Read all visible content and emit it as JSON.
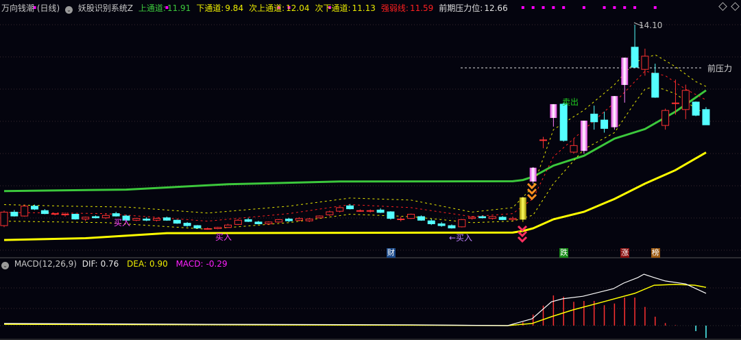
{
  "header": {
    "title": "万向钱潮 (日线)",
    "indicator": "妖股识别系统Z",
    "items": [
      {
        "label": "上通道:",
        "value": "11.91",
        "color": "#3cc83c"
      },
      {
        "label": "下通道:",
        "value": "9.84",
        "color": "#f0f000"
      },
      {
        "label": "次上通道:",
        "value": "12.04",
        "color": "#e8e800"
      },
      {
        "label": "次下通道:",
        "value": "11.13",
        "color": "#e8e800"
      },
      {
        "label": "强弱线:",
        "value": "11.59",
        "color": "#ff2020"
      },
      {
        "label": "前期压力位:",
        "value": "12.66",
        "color": "#e0e0e0"
      }
    ]
  },
  "macd_header": {
    "name": "MACD(12,26,9)",
    "dif_label": "DIF:",
    "dif": "0.76",
    "dea_label": "DEA:",
    "dea": "0.90",
    "macd_label": "MACD:",
    "macd": "-0.29"
  },
  "annotations": {
    "high_label": "14.10",
    "resistance_label": "前压力",
    "buy1": "买入",
    "buy2": "买入",
    "buy3": "←买入",
    "sell": "卖出"
  },
  "events": [
    {
      "index": 38,
      "text": "财",
      "color": "#1c4a8a"
    },
    {
      "index": 55,
      "text": "跌",
      "color": "#188a18"
    },
    {
      "index": 61,
      "text": "涨",
      "color": "#8a1010"
    },
    {
      "index": 64,
      "text": "榜",
      "color": "#9a5810"
    }
  ],
  "colors": {
    "up": "#ff3232",
    "down": "#54ffff",
    "limit": "#ff80ff",
    "gold": "#e0d000",
    "grid": "#3a2a30"
  },
  "chart_data": {
    "type": "candlestick",
    "price_high": 14.1,
    "resistance": 12.66,
    "ylim": [
      6.5,
      14.6
    ],
    "candles_ohlc": [
      [
        7.4,
        7.9,
        7.35,
        7.85
      ],
      [
        7.85,
        7.92,
        7.7,
        7.72
      ],
      [
        7.72,
        8.1,
        7.7,
        8.05
      ],
      [
        8.05,
        8.1,
        7.92,
        7.95
      ],
      [
        7.9,
        7.95,
        7.78,
        7.8
      ],
      [
        7.78,
        7.82,
        7.74,
        7.8
      ],
      [
        7.78,
        7.84,
        7.7,
        7.78
      ],
      [
        7.78,
        7.8,
        7.6,
        7.62
      ],
      [
        7.62,
        7.7,
        7.55,
        7.68
      ],
      [
        7.7,
        7.74,
        7.64,
        7.66
      ],
      [
        7.66,
        7.78,
        7.62,
        7.74
      ],
      [
        7.8,
        7.86,
        7.7,
        7.72
      ],
      [
        7.72,
        7.76,
        7.56,
        7.58
      ],
      [
        7.58,
        7.66,
        7.55,
        7.64
      ],
      [
        7.62,
        7.68,
        7.55,
        7.58
      ],
      [
        7.58,
        7.66,
        7.54,
        7.64
      ],
      [
        7.66,
        7.7,
        7.56,
        7.58
      ],
      [
        7.58,
        7.6,
        7.46,
        7.48
      ],
      [
        7.48,
        7.52,
        7.36,
        7.4
      ],
      [
        7.4,
        7.42,
        7.3,
        7.32
      ],
      [
        7.3,
        7.34,
        7.26,
        7.3
      ],
      [
        7.3,
        7.36,
        7.28,
        7.34
      ],
      [
        7.34,
        7.46,
        7.32,
        7.42
      ],
      [
        7.44,
        7.62,
        7.42,
        7.58
      ],
      [
        7.6,
        7.66,
        7.52,
        7.54
      ],
      [
        7.52,
        7.56,
        7.44,
        7.46
      ],
      [
        7.46,
        7.54,
        7.42,
        7.52
      ],
      [
        7.52,
        7.62,
        7.5,
        7.6
      ],
      [
        7.62,
        7.66,
        7.52,
        7.56
      ],
      [
        7.58,
        7.68,
        7.54,
        7.64
      ],
      [
        7.56,
        7.66,
        7.52,
        7.62
      ],
      [
        7.66,
        7.74,
        7.64,
        7.72
      ],
      [
        7.76,
        7.9,
        7.72,
        7.86
      ],
      [
        7.88,
        8.02,
        7.84,
        8.0
      ],
      [
        8.06,
        8.12,
        7.94,
        7.96
      ],
      [
        7.9,
        7.94,
        7.86,
        7.9
      ],
      [
        7.88,
        7.94,
        7.84,
        7.9
      ],
      [
        7.92,
        7.98,
        7.82,
        7.84
      ],
      [
        7.86,
        7.88,
        7.6,
        7.64
      ],
      [
        7.62,
        7.7,
        7.54,
        7.62
      ],
      [
        7.64,
        7.8,
        7.62,
        7.78
      ],
      [
        7.7,
        7.74,
        7.56,
        7.58
      ],
      [
        7.56,
        7.62,
        7.42,
        7.46
      ],
      [
        7.46,
        7.52,
        7.36,
        7.4
      ],
      [
        7.4,
        7.44,
        7.3,
        7.32
      ],
      [
        7.36,
        7.62,
        7.34,
        7.6
      ],
      [
        7.64,
        7.72,
        7.6,
        7.68
      ],
      [
        7.7,
        7.74,
        7.64,
        7.66
      ],
      [
        7.64,
        7.72,
        7.6,
        7.7
      ],
      [
        7.68,
        7.72,
        7.58,
        7.6
      ],
      [
        7.6,
        7.7,
        7.56,
        7.64
      ],
      [
        7.6,
        8.36,
        7.52,
        8.34
      ],
      [
        8.87,
        9.35,
        8.8,
        9.33
      ],
      [
        10.26,
        10.36,
        9.98,
        10.26
      ],
      [
        10.99,
        11.45,
        10.7,
        11.45
      ],
      [
        11.45,
        11.5,
        10.2,
        10.24
      ],
      [
        9.85,
        10.3,
        9.8,
        10.07
      ],
      [
        9.89,
        10.9,
        9.8,
        10.9
      ],
      [
        11.12,
        11.4,
        10.6,
        10.86
      ],
      [
        10.92,
        11.2,
        10.5,
        10.64
      ],
      [
        10.68,
        11.72,
        10.6,
        11.72
      ],
      [
        12.09,
        13.0,
        11.5,
        13.0
      ],
      [
        13.35,
        14.1,
        12.68,
        12.68
      ],
      [
        12.61,
        13.3,
        12.4,
        13.05
      ],
      [
        12.48,
        12.8,
        11.66,
        11.68
      ],
      [
        10.74,
        11.3,
        10.6,
        11.24
      ],
      [
        11.49,
        12.27,
        11.1,
        11.49
      ],
      [
        11.27,
        12.1,
        10.95,
        11.91
      ],
      [
        11.52,
        11.54,
        11.05,
        11.08
      ],
      [
        11.27,
        11.35,
        10.76,
        10.76
      ]
    ],
    "limit_up_indices": [
      52,
      54,
      57,
      60,
      61
    ],
    "gold_indices": [
      51
    ],
    "signal_dot_indices": [
      3,
      16,
      27,
      28,
      32,
      51,
      52,
      53,
      54,
      55,
      57,
      59,
      60,
      61,
      62,
      64
    ],
    "series": [
      {
        "name": "上通道",
        "color": "#3cc83c",
        "style": "thick",
        "points": [
          [
            0,
            8.55
          ],
          [
            12,
            8.6
          ],
          [
            22,
            8.78
          ],
          [
            33,
            8.87
          ],
          [
            50,
            8.88
          ],
          [
            51,
            8.92
          ],
          [
            52,
            9.03
          ],
          [
            54,
            9.4
          ],
          [
            57,
            9.73
          ],
          [
            60,
            10.3
          ],
          [
            63,
            10.62
          ],
          [
            66,
            11.2
          ],
          [
            69,
            11.91
          ]
        ]
      },
      {
        "name": "下通道",
        "color": "#ffff00",
        "style": "thick",
        "points": [
          [
            0,
            6.92
          ],
          [
            8,
            6.98
          ],
          [
            16,
            7.15
          ],
          [
            50,
            7.17
          ],
          [
            51,
            7.22
          ],
          [
            52,
            7.31
          ],
          [
            54,
            7.61
          ],
          [
            57,
            7.86
          ],
          [
            60,
            8.29
          ],
          [
            63,
            8.8
          ],
          [
            66,
            9.25
          ],
          [
            69,
            9.84
          ]
        ]
      },
      {
        "name": "次上通道",
        "color": "#e8e800",
        "style": "dash",
        "points": [
          [
            0,
            8.1
          ],
          [
            6,
            8.05
          ],
          [
            12,
            8.02
          ],
          [
            20,
            7.82
          ],
          [
            28,
            8.05
          ],
          [
            34,
            8.32
          ],
          [
            40,
            8.25
          ],
          [
            46,
            7.85
          ],
          [
            50,
            8.0
          ],
          [
            52,
            8.7
          ],
          [
            54,
            10.6
          ],
          [
            57,
            11.25
          ],
          [
            60,
            12.1
          ],
          [
            62,
            12.85
          ],
          [
            64,
            13.1
          ],
          [
            66,
            12.7
          ],
          [
            68,
            12.2
          ],
          [
            69,
            12.04
          ]
        ]
      },
      {
        "name": "强弱线",
        "color": "#ff2020",
        "style": "dash",
        "points": [
          [
            0,
            7.84
          ],
          [
            10,
            7.8
          ],
          [
            20,
            7.55
          ],
          [
            28,
            7.8
          ],
          [
            34,
            8.1
          ],
          [
            40,
            8.0
          ],
          [
            46,
            7.7
          ],
          [
            50,
            7.8
          ],
          [
            52,
            8.3
          ],
          [
            54,
            9.7
          ],
          [
            57,
            10.6
          ],
          [
            60,
            11.5
          ],
          [
            62,
            12.2
          ],
          [
            63,
            12.55
          ],
          [
            65,
            12.4
          ],
          [
            67,
            11.95
          ],
          [
            69,
            11.59
          ]
        ]
      },
      {
        "name": "次下通道",
        "color": "#e8e800",
        "style": "dash",
        "points": [
          [
            0,
            7.55
          ],
          [
            10,
            7.5
          ],
          [
            20,
            7.28
          ],
          [
            28,
            7.5
          ],
          [
            34,
            7.78
          ],
          [
            40,
            7.7
          ],
          [
            46,
            7.5
          ],
          [
            50,
            7.55
          ],
          [
            52,
            7.75
          ],
          [
            54,
            8.8
          ],
          [
            57,
            9.95
          ],
          [
            60,
            10.5
          ],
          [
            62,
            11.5
          ],
          [
            63,
            11.95
          ],
          [
            64,
            12.04
          ],
          [
            66,
            11.8
          ],
          [
            68,
            11.3
          ],
          [
            69,
            11.13
          ]
        ]
      }
    ],
    "macd": {
      "dif_points": [
        [
          0,
          0.05
        ],
        [
          20,
          0.03
        ],
        [
          40,
          0.02
        ],
        [
          49.5,
          0
        ],
        [
          51.9,
          0.16
        ],
        [
          53.8,
          0.56
        ],
        [
          54.9,
          0.63
        ],
        [
          56.9,
          0.69
        ],
        [
          58.9,
          0.81
        ],
        [
          59.9,
          0.87
        ],
        [
          60.9,
          1.0
        ],
        [
          62.3,
          1.13
        ],
        [
          62.9,
          1.21
        ],
        [
          63.9,
          1.13
        ],
        [
          65,
          1.05
        ],
        [
          67,
          0.98
        ],
        [
          69,
          0.76
        ]
      ],
      "dea_points": [
        [
          0,
          0.03
        ],
        [
          20,
          0.02
        ],
        [
          40,
          0.01
        ],
        [
          49.5,
          0
        ],
        [
          51.9,
          0.05
        ],
        [
          53.8,
          0.21
        ],
        [
          55.9,
          0.37
        ],
        [
          58.9,
          0.56
        ],
        [
          62,
          0.76
        ],
        [
          63.9,
          0.95
        ],
        [
          66,
          0.97
        ],
        [
          67.9,
          0.95
        ],
        [
          69,
          0.9
        ]
      ],
      "hist_start_index": 51,
      "hist": [
        0.08,
        0.26,
        0.47,
        0.71,
        0.68,
        0.56,
        0.58,
        0.58,
        0.48,
        0.52,
        0.66,
        0.66,
        0.44,
        0.21,
        0.06,
        0.01,
        0.0,
        -0.13,
        -0.29
      ]
    }
  }
}
